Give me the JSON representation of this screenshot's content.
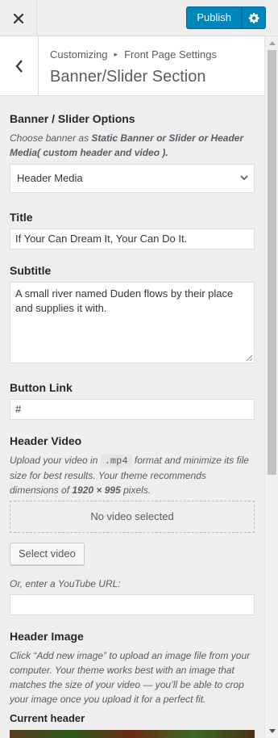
{
  "header": {
    "close_icon": "close-icon",
    "publish_label": "Publish",
    "settings_icon": "gear-icon",
    "accent_color": "#0085ba"
  },
  "section": {
    "back_icon": "chevron-left-icon",
    "breadcrumb_root": "Customizing",
    "breadcrumb_parent": "Front Page Settings",
    "title": "Banner/Slider Section"
  },
  "banner_options": {
    "title": "Banner / Slider Options",
    "desc_prefix": "Choose banner as ",
    "desc_bold": "Static Banner or Slider or Header Media( custom header and video ).",
    "selected": "Header Media"
  },
  "title_field": {
    "label": "Title",
    "value": "If Your Can Dream It, Your Can Do It."
  },
  "subtitle_field": {
    "label": "Subtitle",
    "value": "A small river named Duden flows by their place and supplies it with."
  },
  "button_link": {
    "label": "Button Link",
    "value": "#"
  },
  "header_video": {
    "label": "Header Video",
    "desc_1": "Upload your video in ",
    "format": ".mp4",
    "desc_2": " format and minimize its file size for best results. Your theme recommends dimensions of ",
    "dimensions": "1920 × 995",
    "desc_3": " pixels.",
    "no_video": "No video selected",
    "select_button": "Select video",
    "youtube_label": "Or, enter a YouTube URL:",
    "youtube_value": ""
  },
  "header_image": {
    "label": "Header Image",
    "desc": "Click “Add new image” to upload an image file from your computer. Your theme works best with an image that matches the size of your video — you’ll be able to crop your image once you upload it for a perfect fit.",
    "current_label": "Current header"
  }
}
